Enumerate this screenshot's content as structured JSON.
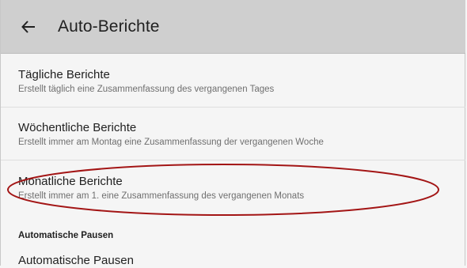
{
  "appbar": {
    "title": "Auto-Berichte",
    "back_icon": "arrow-left-icon"
  },
  "items": [
    {
      "title": "Tägliche Berichte",
      "subtitle": "Erstellt täglich eine Zusammenfassung des vergangenen Tages"
    },
    {
      "title": "Wöchentliche Berichte",
      "subtitle": "Erstellt immer am Montag eine Zusammenfassung der vergangenen Woche"
    },
    {
      "title": "Monatliche Berichte",
      "subtitle": "Erstellt immer am 1. eine Zusammenfassung des vergangenen Monats"
    }
  ],
  "section": {
    "header": "Automatische Pausen",
    "first_item_title": "Automatische Pausen"
  },
  "colors": {
    "appbar": "#cfcfcf",
    "background": "#f5f5f5",
    "annotation": "#a31515"
  }
}
